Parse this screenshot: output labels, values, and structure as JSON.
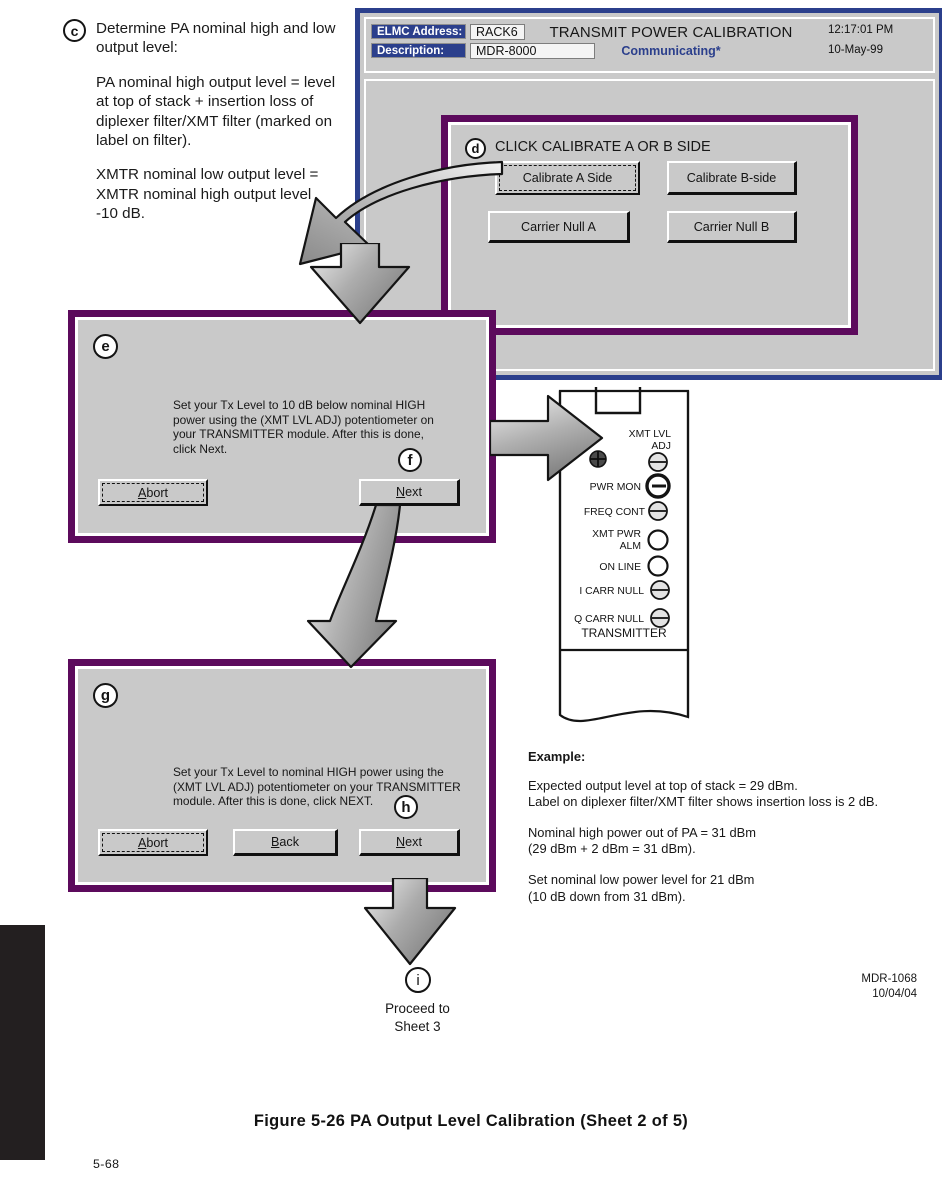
{
  "step_c": {
    "callout": "c",
    "paragraphs": [
      "Determine PA nominal high and low output level:",
      "PA nominal high output level = level at top of stack + insertion loss of diplexer filter/XMT filter (marked on label on filter).",
      "XMTR nominal low output level = XMTR nominal high output level  -10 dB."
    ]
  },
  "app_window": {
    "elmc_label": "ELMC Address:",
    "elmc_value": "RACK6",
    "description_label": "Description:",
    "description_value": "MDR-8000",
    "title": "TRANSMIT POWER CALIBRATION",
    "status": "Communicating*",
    "time": "12:17:01 PM",
    "date": "10-May-99"
  },
  "dialog_d": {
    "callout": "d",
    "title": "CLICK CALIBRATE A OR B SIDE",
    "buttons": {
      "calibrate_a": "Calibrate A Side",
      "calibrate_b": "Calibrate B-side",
      "carrier_null_a": "Carrier Null A",
      "carrier_null_b": "Carrier Null B"
    }
  },
  "dialog_e": {
    "callout": "e",
    "text": "Set your Tx Level to 10 dB below nominal HIGH power using the (XMT LVL ADJ) potentiometer on your TRANSMITTER module. After this is done, click Next.",
    "abort_mnemonic": "A",
    "abort_rest": "bort",
    "next_mnemonic": "N",
    "next_rest": "ext",
    "next_callout": "f"
  },
  "dialog_g": {
    "callout": "g",
    "text": "Set your Tx Level to nominal HIGH power using the (XMT LVL ADJ) potentiometer on your TRANSMITTER module. After this is done, click NEXT.",
    "abort_mnemonic": "A",
    "abort_rest": "bort",
    "back_mnemonic": "B",
    "back_rest": "ack",
    "next_mnemonic": "N",
    "next_rest": "ext",
    "next_callout": "h"
  },
  "transmitter_module": {
    "name": "TRANSMITTER",
    "controls": [
      {
        "label_line1": "XMT LVL",
        "label_line2": "ADJ",
        "type": "slotted-screw"
      },
      {
        "label_line1": "PWR MON",
        "label_line2": "",
        "type": "test-jack"
      },
      {
        "label_line1": "FREQ CONT",
        "label_line2": "",
        "type": "slotted-screw"
      },
      {
        "label_line1": "XMT PWR",
        "label_line2": "ALM",
        "type": "led"
      },
      {
        "label_line1": "ON LINE",
        "label_line2": "",
        "type": "led"
      },
      {
        "label_line1": "I CARR NULL",
        "label_line2": "",
        "type": "slotted-screw"
      },
      {
        "label_line1": "Q CARR NULL",
        "label_line2": "",
        "type": "slotted-screw"
      }
    ]
  },
  "example": {
    "title": "Example:",
    "paragraphs": [
      "Expected output level at top of stack = 29 dBm.\nLabel on diplexer filter/XMT filter shows insertion loss is 2 dB.",
      "Nominal high power out of PA = 31 dBm\n(29 dBm + 2 dBm = 31 dBm).",
      "Set nominal low power level for 21 dBm\n(10 dB down from 31 dBm)."
    ]
  },
  "proceed": {
    "callout": "i",
    "text": "Proceed to\nSheet 3"
  },
  "footer": {
    "doc_id": "MDR-1068\n10/04/04",
    "figure_caption": "Figure 5-26  PA Output Level Calibration (Sheet 2 of 5)",
    "page_number": "5-68"
  },
  "colors": {
    "window_frame": "#2b3f8c",
    "dialog_border": "#5c0a5c",
    "face": "#c9c9c9",
    "status_text": "#2b3f8c"
  }
}
